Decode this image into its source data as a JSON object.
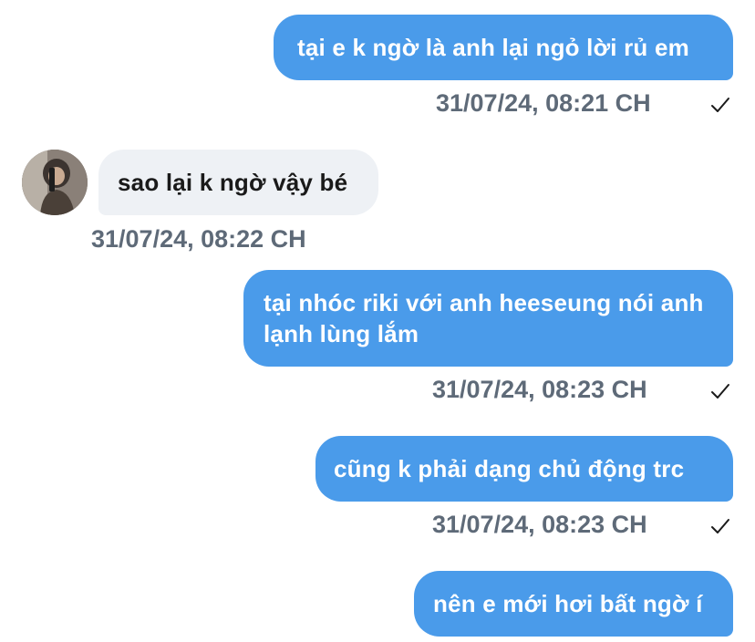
{
  "colors": {
    "outgoing_bubble": "#4a9bea",
    "incoming_bubble": "#eef1f5",
    "timestamp_text": "#5e6a78"
  },
  "messages": [
    {
      "direction": "outgoing",
      "text": "tại e k ngờ là anh lại ngỏ lời rủ em",
      "timestamp": "31/07/24, 08:21 CH",
      "status_icon": "check-icon"
    },
    {
      "direction": "incoming",
      "text": "sao lại k ngờ vậy bé",
      "timestamp": "31/07/24, 08:22 CH",
      "avatar_icon": "avatar-photo"
    },
    {
      "direction": "outgoing",
      "text": "tại nhóc riki với anh heeseung nói anh lạnh lùng lắm",
      "timestamp": "31/07/24, 08:23 CH",
      "status_icon": "check-icon"
    },
    {
      "direction": "outgoing",
      "text": "cũng k phải dạng chủ động trc",
      "timestamp": "31/07/24, 08:23 CH",
      "status_icon": "check-icon"
    },
    {
      "direction": "outgoing",
      "text": "nên e mới hơi bất ngờ í"
    }
  ]
}
